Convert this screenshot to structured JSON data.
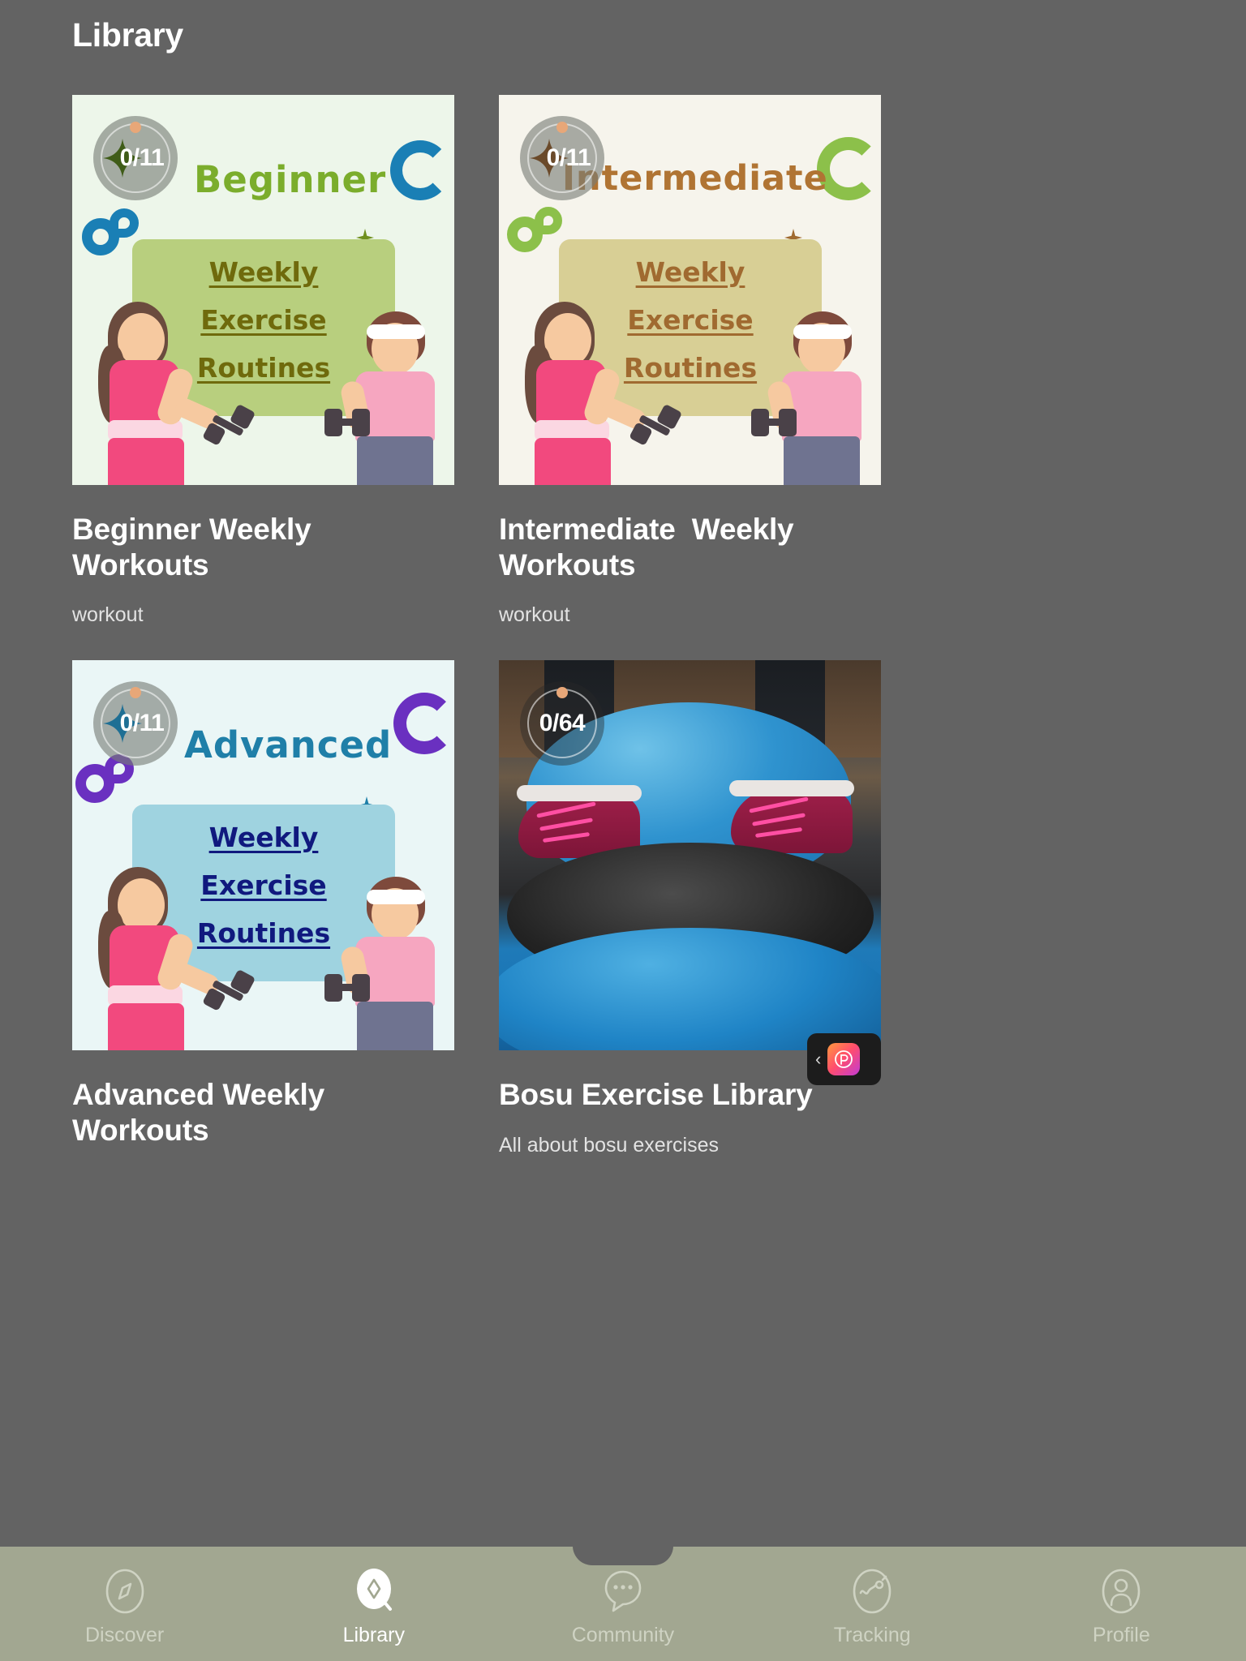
{
  "header": {
    "title": "Library"
  },
  "theme": {
    "background": "#636363",
    "nav_bar": "#a2a791",
    "nav_active_text": "#ffffff",
    "nav_inactive_text": "#cfd3c3",
    "badge_dot": "#e8a778",
    "title_text": "#ffffff",
    "subtitle_text": "#e3e3e3"
  },
  "cards": [
    {
      "title": "Beginner Weekly Workouts",
      "subtitle": "workout",
      "badge": {
        "progress": "0/11",
        "icon": "sparkle-icon",
        "style": "light"
      },
      "poster": {
        "kind": "illustration",
        "level_label": "Beginner",
        "level_color": "#7bad2c",
        "bg": "#edf6ea",
        "board_bg": "#b8cf7e",
        "board_text_color": "#6f6a0c",
        "lines": [
          "Weekly",
          "Exercise",
          "Routines"
        ],
        "swirl_colors": [
          "#1a7fb5",
          "#1a7fb5"
        ],
        "spark_color": "#6f8f1e"
      }
    },
    {
      "title": "Intermediate  Weekly Workouts",
      "subtitle": "workout",
      "badge": {
        "progress": "0/11",
        "icon": "sparkle-icon",
        "style": "light"
      },
      "poster": {
        "kind": "illustration",
        "level_label": "Intermediate",
        "level_color": "#b07433",
        "bg": "#f6f4ec",
        "board_bg": "#d8cf95",
        "board_text_color": "#a06a30",
        "lines": [
          "Weekly",
          "Exercise",
          "Routines"
        ],
        "swirl_colors": [
          "#8cc04a",
          "#8cc04a"
        ],
        "spark_color": "#a06a30"
      }
    },
    {
      "title": "Advanced Weekly Workouts",
      "subtitle": "",
      "badge": {
        "progress": "0/11",
        "icon": "sparkle-icon",
        "style": "light"
      },
      "poster": {
        "kind": "illustration",
        "level_label": "Advanced",
        "level_color": "#1f7fa8",
        "bg": "#eaf6f6",
        "board_bg": "#9fd3e0",
        "board_text_color": "#10197e",
        "lines": [
          "Weekly",
          "Exercise",
          "Routines"
        ],
        "swirl_colors": [
          "#6a30c0",
          "#6a30c0"
        ],
        "spark_color": "#1f7fa8"
      }
    },
    {
      "title": "Bosu Exercise Library",
      "subtitle": "All about bosu exercises",
      "badge": {
        "progress": "0/64",
        "icon": "none",
        "style": "dark"
      },
      "poster": {
        "kind": "photo",
        "description": "bosu-ball-photo"
      }
    }
  ],
  "overlay_button": {
    "chevron": "‹",
    "logo_glyph": "Ⓟ",
    "name": "floating-app-switcher"
  },
  "bottom_nav": {
    "items": [
      {
        "label": "Discover",
        "icon": "compass-icon",
        "active": false
      },
      {
        "label": "Library",
        "icon": "library-icon",
        "active": true
      },
      {
        "label": "Community",
        "icon": "chat-icon",
        "active": false
      },
      {
        "label": "Tracking",
        "icon": "pulse-icon",
        "active": false
      },
      {
        "label": "Profile",
        "icon": "person-icon",
        "active": false
      }
    ]
  }
}
